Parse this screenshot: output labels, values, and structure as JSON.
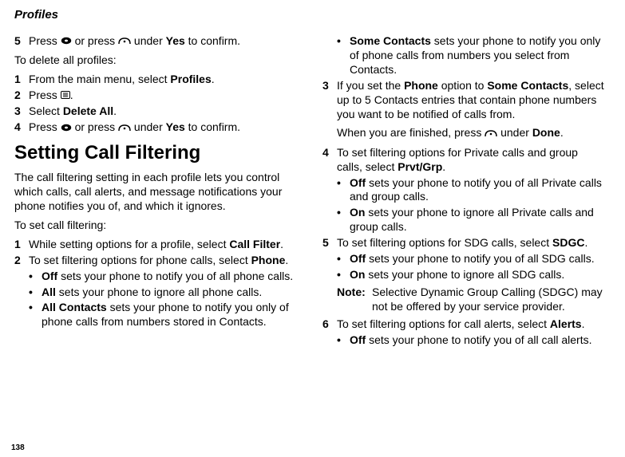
{
  "header": "Profiles",
  "pageNumber": "138",
  "left": {
    "s5": {
      "num": "5",
      "pre": "Press ",
      "mid": " or press ",
      "post": " under ",
      "yes": "Yes",
      "tail": " to confirm."
    },
    "delIntro": "To delete all profiles:",
    "d1": {
      "num": "1",
      "a": "From the main menu, select ",
      "b": "Profiles",
      "c": "."
    },
    "d2": {
      "num": "2",
      "a": "Press ",
      "b": "."
    },
    "d3": {
      "num": "3",
      "a": "Select ",
      "b": "Delete All",
      "c": "."
    },
    "d4": {
      "num": "4",
      "pre": "Press ",
      "mid": " or press ",
      "post": " under ",
      "yes": "Yes",
      "tail": " to confirm."
    },
    "h2": "Setting Call Filtering",
    "desc": "The call filtering setting in each profile lets you control which calls, call alerts, and message notifications your phone notifies you of, and which it ignores.",
    "toSet": "To set call filtering:",
    "c1": {
      "num": "1",
      "a": "While setting options for a profile, select ",
      "b": "Call Filter",
      "c": "."
    },
    "c2": {
      "num": "2",
      "a": "To set filtering options for phone calls, select ",
      "b": "Phone",
      "c": "."
    },
    "c2a": {
      "b": "Off",
      "t": " sets your phone to notify you of all phone calls."
    },
    "c2b": {
      "b": "All",
      "t": " sets your phone to ignore all phone calls."
    },
    "c2c": {
      "b": "All Contacts",
      "t": " sets your phone to notify you only of phone calls from numbers stored in Contacts."
    }
  },
  "right": {
    "c2d": {
      "b": "Some Contacts",
      "t": " sets your phone to notify you only of phone calls from numbers you select from Contacts."
    },
    "c3": {
      "num": "3",
      "a": "If you set the ",
      "b": "Phone",
      "c": " option to ",
      "d": "Some Contacts",
      "e": ", select up to 5 Contacts entries that contain phone numbers you want to be notified of calls from."
    },
    "c3b": {
      "a": "When you are finished, press ",
      "b": " under ",
      "c": "Done",
      "d": "."
    },
    "c4": {
      "num": "4",
      "a": "To set filtering options for Private calls and group calls, select ",
      "b": "Prvt/Grp",
      "c": "."
    },
    "c4a": {
      "b": "Off",
      "t": " sets your phone to notify you of all Private calls and group calls."
    },
    "c4b": {
      "b": "On",
      "t": " sets your phone to ignore all Private calls and group calls."
    },
    "c5": {
      "num": "5",
      "a": "To set filtering options for SDG calls, select ",
      "b": "SDGC",
      "c": "."
    },
    "c5a": {
      "b": "Off",
      "t": " sets your phone to notify you of all SDG calls."
    },
    "c5b": {
      "b": "On",
      "t": " sets your phone to ignore all SDG calls."
    },
    "note": {
      "lbl": "Note:",
      "t": "Selective Dynamic Group Calling (SDGC) may not be offered by your service provider."
    },
    "c6": {
      "num": "6",
      "a": "To set filtering options for call alerts, select ",
      "b": "Alerts",
      "c": "."
    },
    "c6a": {
      "b": "Off",
      "t": " sets your phone to notify you of all call alerts."
    }
  }
}
